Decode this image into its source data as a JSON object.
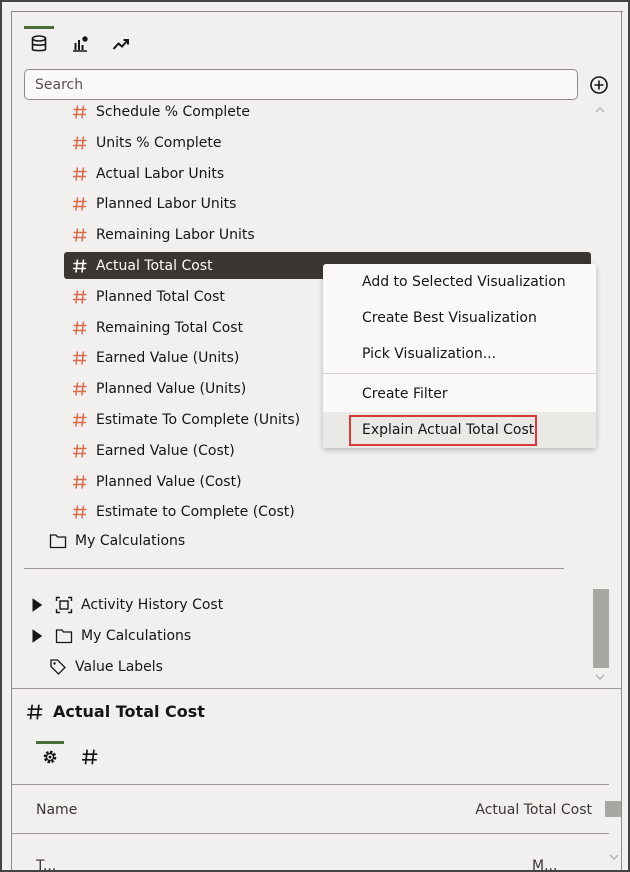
{
  "tabs": [
    {
      "icon": "database-icon",
      "active": true
    },
    {
      "icon": "visualization-chart-icon",
      "active": false
    },
    {
      "icon": "analytics-trend-icon",
      "active": false
    }
  ],
  "search": {
    "placeholder": "Search"
  },
  "fields": [
    {
      "label": "Schedule % Complete"
    },
    {
      "label": "Units % Complete"
    },
    {
      "label": "Actual Labor Units"
    },
    {
      "label": "Planned Labor Units"
    },
    {
      "label": "Remaining Labor Units"
    },
    {
      "label": "Actual Total Cost",
      "selected": true
    },
    {
      "label": "Planned Total Cost"
    },
    {
      "label": "Remaining Total Cost"
    },
    {
      "label": "Earned Value (Units)"
    },
    {
      "label": "Planned Value (Units)"
    },
    {
      "label": "Estimate To Complete (Units)"
    },
    {
      "label": "Earned Value (Cost)"
    },
    {
      "label": "Planned Value (Cost)"
    },
    {
      "label": "Estimate to Complete (Cost)"
    }
  ],
  "sub_folder": {
    "label": "My Calculations"
  },
  "context_menu": {
    "items": [
      {
        "label": "Add to Selected Visualization"
      },
      {
        "label": "Create Best Visualization"
      },
      {
        "label": "Pick Visualization..."
      },
      {
        "label": "Create Filter"
      },
      {
        "label": "Explain Actual Total Cost",
        "highlighted": true
      }
    ]
  },
  "tree": {
    "items": [
      {
        "label": "Activity History Cost",
        "icon": "dataset-icon",
        "expandable": true
      },
      {
        "label": "My Calculations",
        "icon": "folder-icon",
        "expandable": true
      },
      {
        "label": "Value Labels",
        "icon": "tag-icon",
        "expandable": false
      }
    ]
  },
  "properties": {
    "title": "Actual Total Cost",
    "tabs": [
      {
        "icon": "gear-icon",
        "active": true
      },
      {
        "icon": "hash-icon",
        "active": false
      }
    ],
    "rows": [
      {
        "name": "Name",
        "value": "Actual Total Cost"
      }
    ],
    "partial_row": {
      "name": "T...",
      "value": "M..."
    }
  },
  "colors": {
    "accent_green": "#4a6b3a",
    "hash_orange": "#d96c4f",
    "selected_bg": "#3a3631",
    "highlight_border": "#d63b3b"
  }
}
